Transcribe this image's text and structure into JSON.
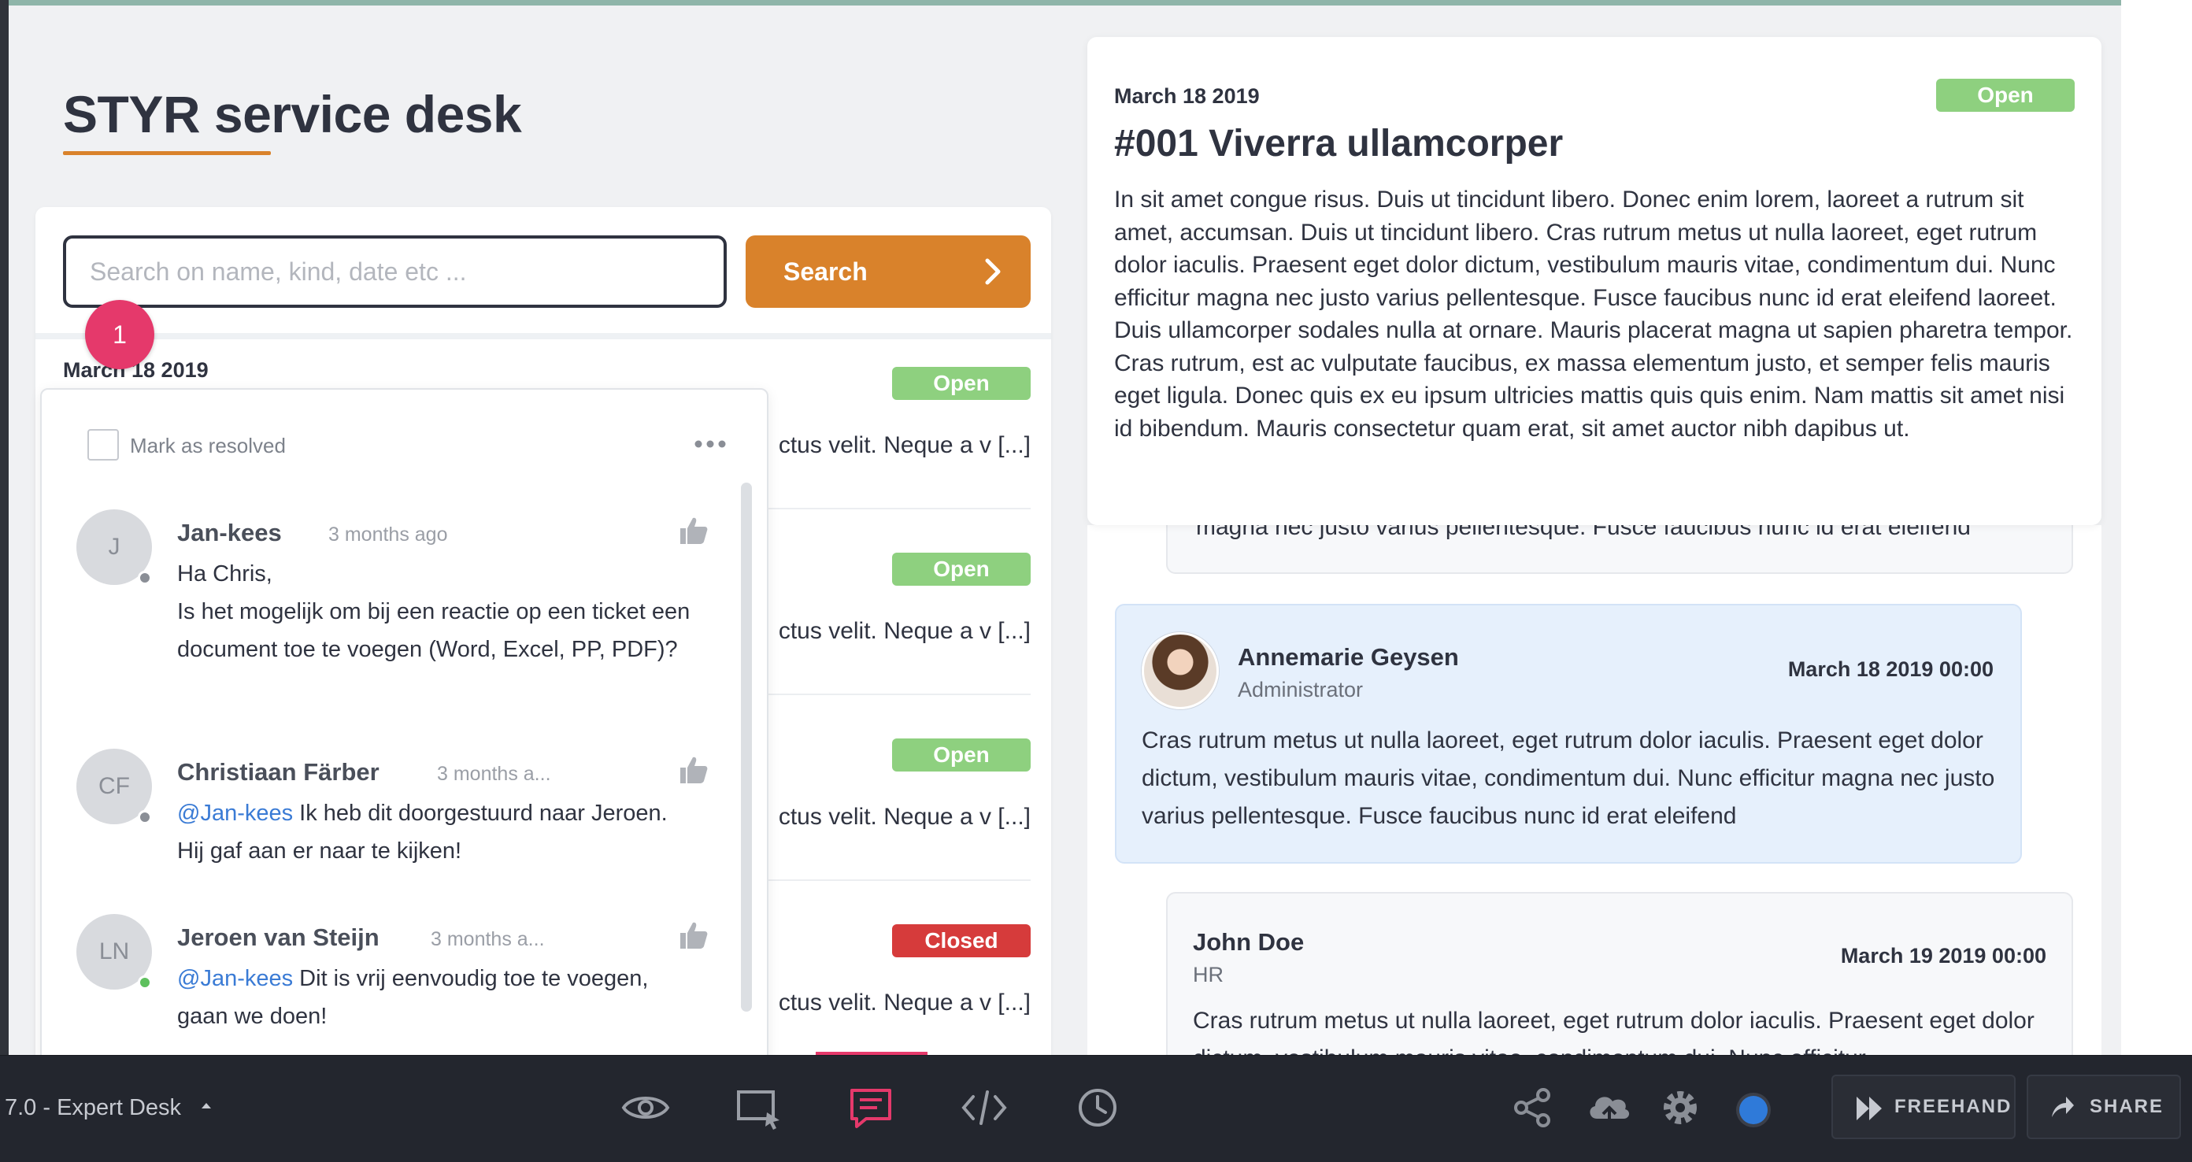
{
  "app": {
    "title": "STYR service desk",
    "search_placeholder": "Search on name, kind, date etc ...",
    "search_value": "",
    "search_label": "Search"
  },
  "ticket_list": {
    "date": "March 18 2019",
    "rows": [
      {
        "status": "Open",
        "snippet": "ctus velit. Neque a v [...]"
      },
      {
        "status": "Open",
        "snippet": "ctus velit. Neque a v [...]"
      },
      {
        "status": "Open",
        "snippet": "ctus velit. Neque a v [...]"
      },
      {
        "status": "Closed",
        "snippet": "ctus velit. Neque a v [...]"
      }
    ]
  },
  "comment_marker": {
    "number": "1"
  },
  "comments_popover": {
    "resolve_label": "Mark as resolved",
    "comments": [
      {
        "initials": "J",
        "author": "Jan-kees",
        "time": "3 months ago",
        "presence": "offline",
        "mention": "",
        "lines": [
          "Ha Chris,",
          "Is het mogelijk om bij een reactie op een ticket een document toe te voegen (Word, Excel, PP, PDF)?"
        ]
      },
      {
        "initials": "CF",
        "author": "Christiaan Färber",
        "time": "3 months a...",
        "presence": "offline",
        "mention": "@Jan-kees",
        "text": " Ik heb dit doorgestuurd naar Jeroen. Hij gaf aan er naar te kijken!"
      },
      {
        "initials": "LN",
        "author": "Jeroen van Steijn",
        "time": "3 months a...",
        "presence": "online",
        "mention": "@Jan-kees",
        "text": " Dit is vrij eenvoudig toe te voegen, gaan we doen!"
      }
    ]
  },
  "ticket_detail": {
    "date": "March 18 2019",
    "status": "Open",
    "title": "#001 Viverra ullamcorper",
    "body": "In sit amet congue risus. Duis ut tincidunt libero. Donec enim lorem, laoreet a rutrum sit amet, accumsan. Duis ut tincidunt libero. Cras rutrum metus ut nulla laoreet, eget rutrum dolor iaculis. Praesent eget dolor dictum, vestibulum mauris vitae, condimentum dui. Nunc efficitur magna nec justo varius pellentesque. Fusce faucibus nunc id erat eleifend laoreet. Duis ullamcorper sodales nulla at ornare. Mauris placerat magna ut sapien pharetra tempor. Cras rutrum, est ac vulputate faucibus, ex massa elementum justo, et semper felis mauris eget ligula. Donec quis ex eu ipsum ultricies mattis quis quis enim. Nam mattis sit amet nisi id bibendum. Mauris consectetur quam erat, sit amet auctor nibh dapibus ut."
  },
  "replies": [
    {
      "partial_text": "magna nec justo varius pellentesque. Fusce faucibus nunc id erat eleifend"
    },
    {
      "name": "Annemarie Geysen",
      "role": "Administrator",
      "date": "March 18 2019 00:00",
      "body": "Cras rutrum metus ut nulla laoreet, eget rutrum dolor iaculis. Praesent eget dolor dictum, vestibulum mauris vitae, condimentum dui. Nunc efficitur magna nec justo varius pellentesque. Fusce faucibus nunc id erat eleifend"
    },
    {
      "name": "John Doe",
      "role": "HR",
      "date": "March 19 2019 00:00",
      "body": "Cras rutrum metus ut nulla laoreet, eget rutrum dolor iaculis. Praesent eget dolor dictum, vestibulum mauris vitae, condimentum dui. Nunc efficitur"
    }
  ],
  "toolbar": {
    "project": "7.0 - Expert Desk",
    "freehand_label": "FREEHAND",
    "share_label": "SHARE",
    "icons": [
      "eye-icon",
      "select-area-icon",
      "comment-icon",
      "code-icon",
      "history-icon",
      "share-nodes-icon",
      "cloud-upload-icon",
      "gear-icon",
      "user-dot-icon"
    ]
  },
  "colors": {
    "accent_orange": "#d9822b",
    "open_green": "#8ed07f",
    "closed_red": "#d63b3b",
    "marker_pink": "#e5396b",
    "mention_blue": "#3a7bd5",
    "toolbar_bg": "#23262e"
  }
}
